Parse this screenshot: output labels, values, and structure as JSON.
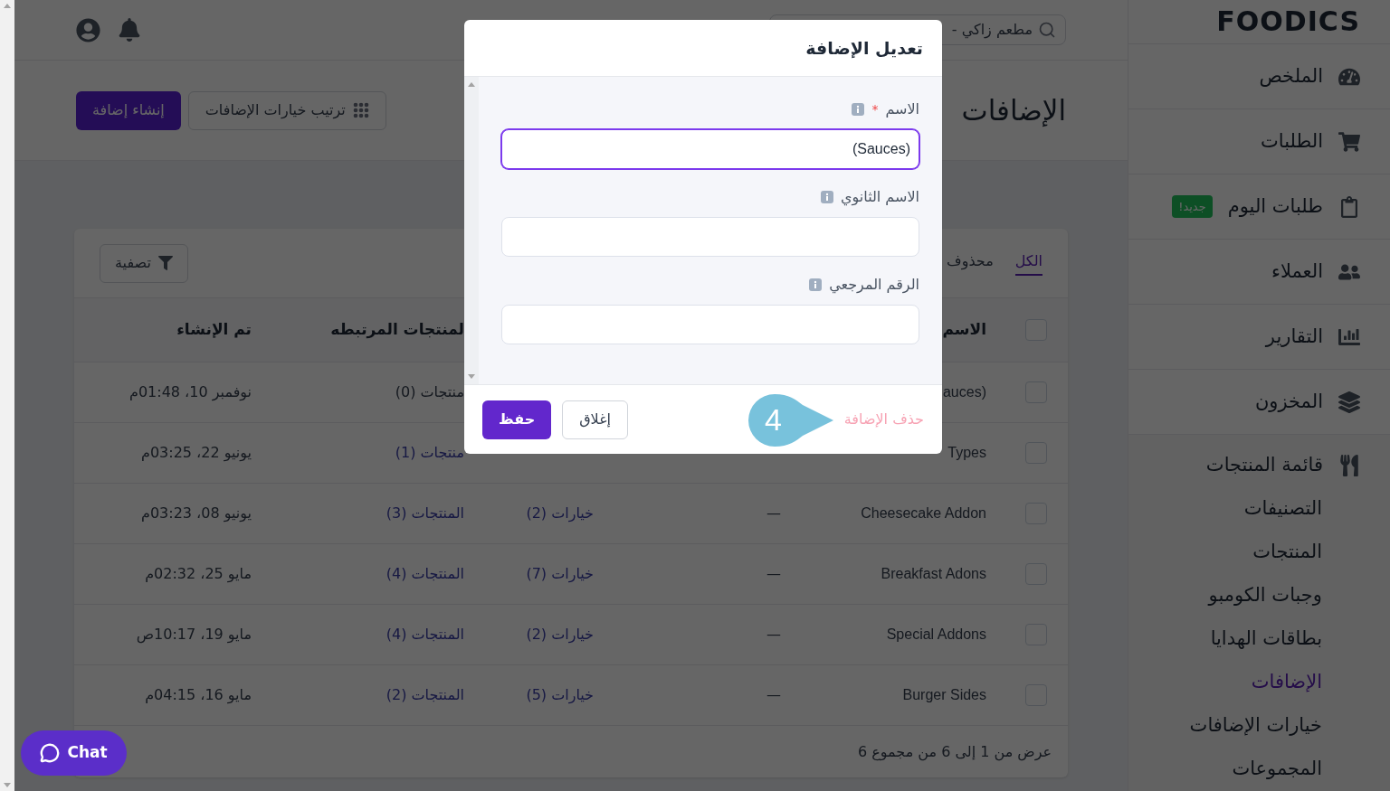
{
  "sidebar": {
    "logo": "FOODICS",
    "items": [
      {
        "label": "الملخص"
      },
      {
        "label": "الطلبات"
      },
      {
        "label": "طلبات اليوم",
        "badge": "جديد!"
      },
      {
        "label": "العملاء"
      },
      {
        "label": "التقارير"
      },
      {
        "label": "المخزون"
      }
    ],
    "menu": {
      "label": "قائمة المنتجات",
      "children": [
        {
          "label": "التصنيفات",
          "selected": false
        },
        {
          "label": "المنتجات",
          "selected": false
        },
        {
          "label": "وجبات الكومبو",
          "selected": false
        },
        {
          "label": "بطاقات الهدايا",
          "selected": false
        },
        {
          "label": "الإضافات",
          "selected": true
        },
        {
          "label": "خيارات الإضافات",
          "selected": false
        },
        {
          "label": "المجموعات",
          "selected": false
        }
      ]
    }
  },
  "header": {
    "business_value": "مطعم زاكي -"
  },
  "page": {
    "title": "الإضافات",
    "buttons": [
      {
        "label": "ترتيب خيارات الإضافات",
        "kind": "outline"
      },
      {
        "label": "إنشاء إضافة",
        "kind": "primary"
      }
    ]
  },
  "card": {
    "tabs": [
      {
        "label": "الكل",
        "selected": true
      },
      {
        "label": "محذوف",
        "selected": false
      }
    ],
    "filter": "تصفية",
    "all_checked": false,
    "columns": {
      "name": "الاسم",
      "linked_products": "لمنتجات المرتبطه",
      "created": "تم الإنشاء"
    },
    "rows": [
      {
        "checked": false,
        "name": "auces)",
        "products": {
          "text": "منتجات (0)",
          "link": false
        },
        "created": "نوفمبر 10، 01:48م"
      },
      {
        "checked": false,
        "name": "Types",
        "products": {
          "text": "منتجات (1)",
          "link": true
        },
        "created": "يونيو 22، 03:25م"
      },
      {
        "checked": false,
        "name": "Cheesecake Addon",
        "column_3": "—",
        "options": "خيارات (2)",
        "products": {
          "text": "المنتجات (3)",
          "link": true
        },
        "created": "يونيو 08، 03:23م"
      },
      {
        "checked": false,
        "name": "Breakfast Adons",
        "column_3": "—",
        "options": "خيارات (7)",
        "products": {
          "text": "المنتجات (4)",
          "link": true
        },
        "created": "مايو 25، 02:32م"
      },
      {
        "checked": false,
        "name": "Special Addons",
        "column_3": "—",
        "options": "خيارات (2)",
        "products": {
          "text": "المنتجات (4)",
          "link": true
        },
        "created": "مايو 19، 10:17ص"
      },
      {
        "checked": false,
        "name": "Burger Sides",
        "column_3": "—",
        "options": "خيارات (5)",
        "products": {
          "text": "المنتجات (2)",
          "link": true
        },
        "created": "مايو 16، 04:15م"
      }
    ],
    "footer": "عرض من 1 إلى 6 من مجموع 6"
  },
  "modal": {
    "title": "تعديل الإضافة",
    "fields": [
      {
        "label": "الاسم",
        "required_mark": "*",
        "value": "(Sauces)",
        "focused": true
      },
      {
        "label": "الاسم الثانوي",
        "focused": false
      },
      {
        "label": "الرقم المرجعي",
        "focused": false
      }
    ],
    "delete_link": "حذف الإضافة",
    "buttons": [
      {
        "label": "إغلاق",
        "kind": "outline"
      },
      {
        "label": "حفظ",
        "kind": "primary"
      }
    ]
  },
  "tour_marker": {
    "number": "4"
  },
  "chat": {
    "label": "Chat"
  }
}
